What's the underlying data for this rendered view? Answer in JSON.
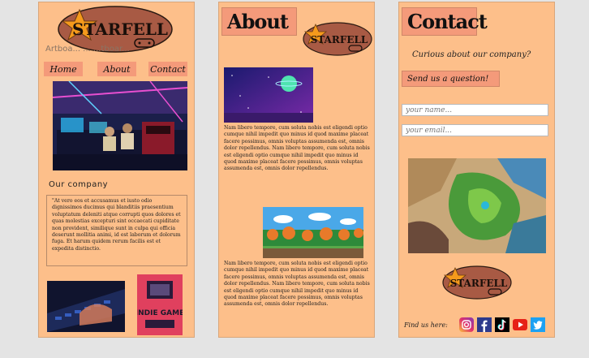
{
  "brand": {
    "logo_text": "STARFELL"
  },
  "artboard_home": {
    "ghost_label": "Artboa...  ...  ...tboar...",
    "nav": [
      {
        "label": "Home"
      },
      {
        "label": "About"
      },
      {
        "label": "Contact"
      }
    ],
    "section_title": "Our company",
    "quote": "\"At vero eos et accusamus et iusto odio dignissimos ducimus qui blanditiis praesentium voluptatum deleniti atque corrupti quos dolores et quas molestias excepturi sint occaecati cupiditate non provident, similique sunt in culpa qui officia deserunt mollitia animi, id est laborum et dolorum fuga. Et harum quidem rerum facilis est et expedita distinctio.",
    "indie_game_text": "INDIE GAME"
  },
  "artboard_about": {
    "title": "About",
    "paragraph_1": "Nam libero tempore, cum soluta nobis est eligendi optio cumque nihil impedit quo minus id quod maxime placeat facere possimus, omnis voluptas assumenda est, omnis dolor repellendus. Nam libero tempore, cum soluta nobis est eligendi optio cumque nihil impedit quo minus id quod maxime placeat facere possimus, omnis voluptas assumenda est, omnis dolor repellendus.",
    "paragraph_2": "Nam libero tempore, cum soluta nobis est eligendi optio cumque nihil impedit quo minus id quod maxime placeat facere possimus, omnis voluptas assumenda est, omnis dolor repellendus. Nam libero tempore, cum soluta nobis est eligendi optio cumque nihil impedit quo minus id quod maxime placeat facere possimus, omnis voluptas assumenda est, omnis dolor repellendus."
  },
  "artboard_contact": {
    "title": "Contact",
    "tagline": "Curious about our company?",
    "ask_button": "Send us a question!",
    "name_placeholder": "your name...",
    "email_placeholder": "your email...",
    "find_us_label": "Find us here:",
    "socials": [
      "instagram-icon",
      "facebook-icon",
      "tiktok-icon",
      "youtube-icon",
      "twitter-icon"
    ]
  },
  "colors": {
    "artboard_bg": "#fdbf8a",
    "button_bg": "#f49a7a",
    "logo_oval": "#a85a44",
    "logo_star": "#f59a1c",
    "canvas_bg": "#e4e4e4"
  }
}
